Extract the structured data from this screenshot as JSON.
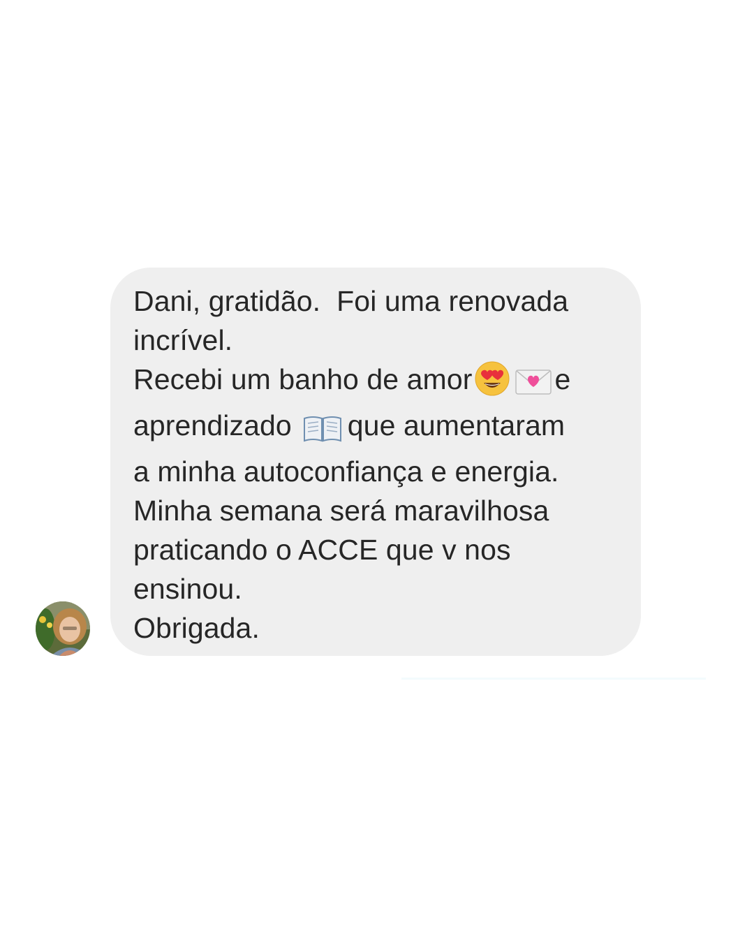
{
  "message": {
    "lines": {
      "l1": "Dani, gratidão.  Foi uma renovada",
      "l2": "incrível.",
      "l3_before": "Recebi um banho de amor",
      "l3_after": "e",
      "l4_before": "aprendizado",
      "l4_after": "que aumentaram",
      "l5": "a minha autoconfiança e energia.",
      "l6": "Minha semana será maravilhosa",
      "l7": "praticando o ACCE que v nos",
      "l8": "ensinou.",
      "l9": "Obrigada."
    },
    "emojis": [
      "heart-eyes-emoji",
      "love-letter-emoji",
      "open-book-emoji"
    ]
  },
  "colors": {
    "bubble": "#efefef",
    "text": "#262626",
    "background": "#ffffff"
  }
}
